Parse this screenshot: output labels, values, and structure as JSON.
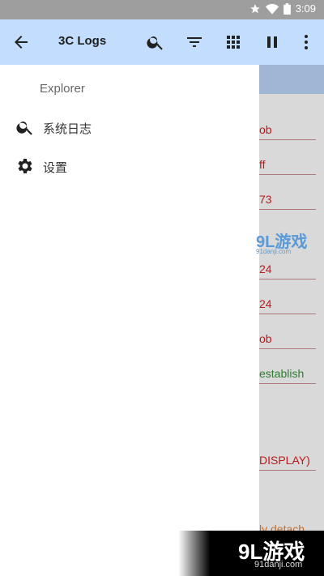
{
  "status_bar": {
    "time": "3:09"
  },
  "app_bar": {
    "title": "3C Logs"
  },
  "drawer": {
    "header": "Explorer",
    "items": [
      {
        "label": "系统日志",
        "icon": "search-icon"
      },
      {
        "label": "设置",
        "icon": "gear-icon"
      }
    ]
  },
  "log_lines": [
    {
      "text": "ob",
      "color": "#b71c1c"
    },
    {
      "text": "ff",
      "color": "#b71c1c"
    },
    {
      "text": "73",
      "color": "#b71c1c"
    },
    {
      "text": "24",
      "color": "#b71c1c"
    },
    {
      "text": "24",
      "color": "#b71c1c"
    },
    {
      "text": "ob",
      "color": "#b71c1c"
    },
    {
      "text": "establish",
      "color": "#2e7d32"
    },
    {
      "text": "DISPLAY)",
      "color": "#b71c1c"
    },
    {
      "text": "ly detach",
      "color": "#c07030"
    }
  ],
  "watermark": {
    "brand": "9L游戏",
    "site": "91danji.com"
  }
}
